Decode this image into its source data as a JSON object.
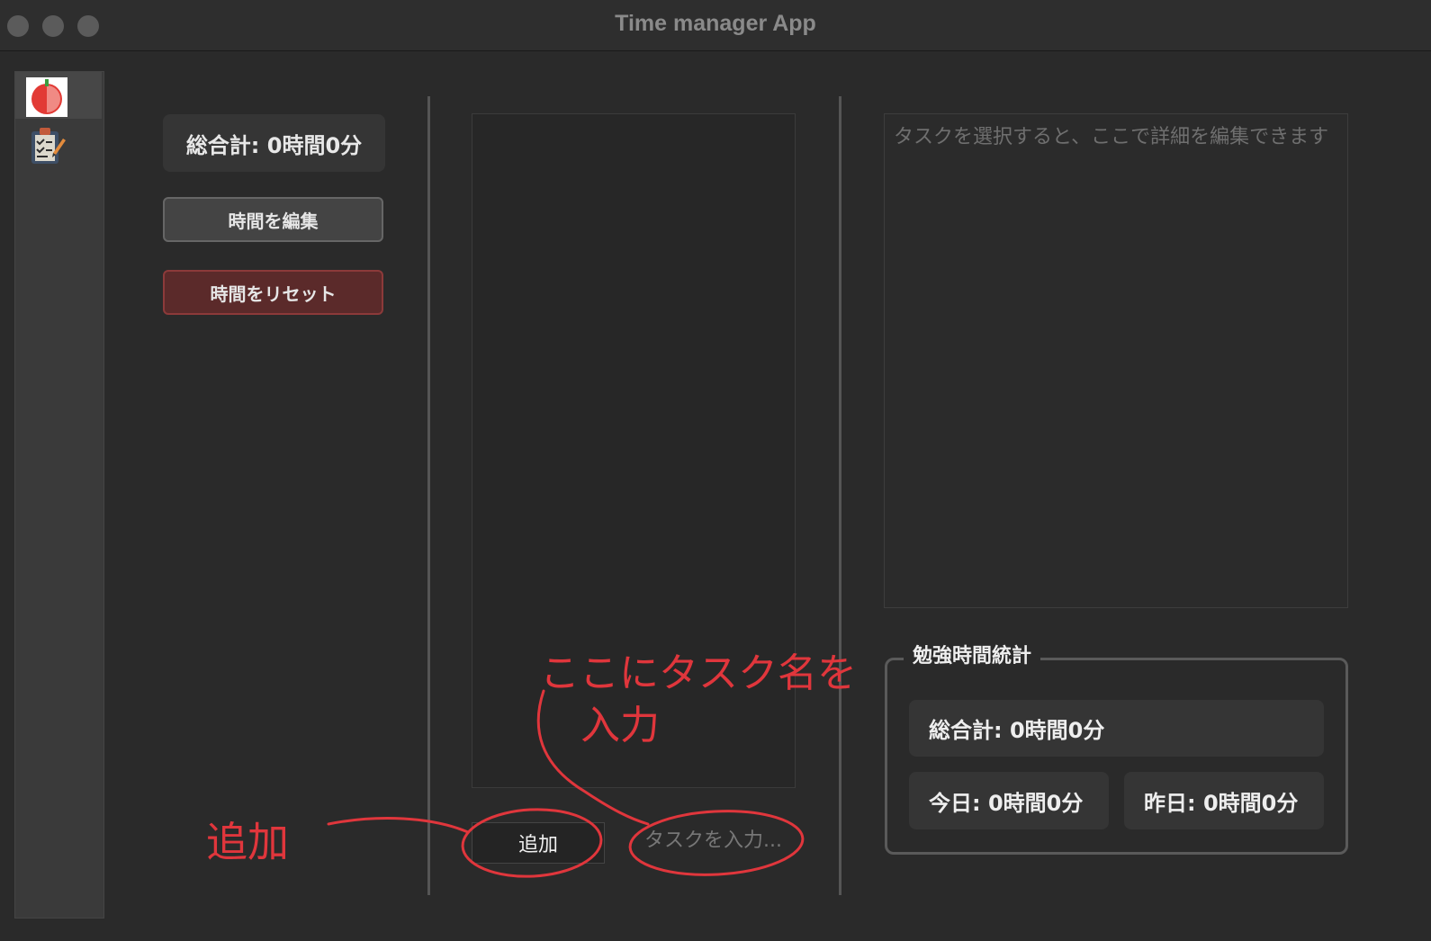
{
  "window": {
    "title": "Time manager App"
  },
  "sidebar": {
    "items": [
      {
        "icon": "tomato-icon",
        "active": true
      },
      {
        "icon": "clipboard-checklist-icon",
        "active": false
      }
    ]
  },
  "timer_panel": {
    "summary": "総合計: 0時間0分",
    "edit_label": "時間を編集",
    "reset_label": "時間をリセット"
  },
  "tasks_panel": {
    "add_label": "追加",
    "input_placeholder": "タスクを入力..."
  },
  "detail_panel": {
    "placeholder": "タスクを選択すると、ここで詳細を編集できます"
  },
  "stats": {
    "title": "勉強時間統計",
    "total": "総合計: 0時間0分",
    "today": "今日: 0時間0分",
    "yesterday": "昨日: 0時間0分"
  },
  "annotations": {
    "add_note": "追加",
    "input_note_line1": "ここにタスク名を",
    "input_note_line2": "入力"
  },
  "colors": {
    "annotation": "#e0363c",
    "reset_button": "#5b2a2a",
    "background": "#2a2a2a"
  }
}
